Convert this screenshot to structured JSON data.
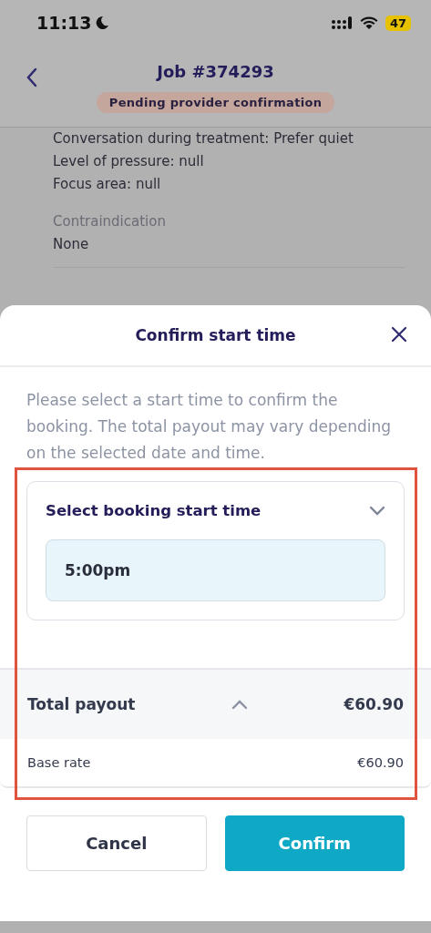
{
  "status_bar": {
    "time": "11:13",
    "battery": "47"
  },
  "header": {
    "title": "Job #374293",
    "status_badge": "Pending provider confirmation"
  },
  "background_details": {
    "lines": [
      "Conversation during treatment: Prefer quiet",
      "Level of pressure: null",
      "Focus area: null"
    ],
    "section_label": "Contraindication",
    "section_value": "None"
  },
  "sheet": {
    "title": "Confirm start time",
    "description": "Please select a start time to confirm the booking. The total payout may vary depending on the selected date and time.",
    "time_picker": {
      "label": "Select booking start time",
      "expanded": true,
      "value": "5:00pm"
    },
    "payout": {
      "label": "Total payout",
      "expanded": true,
      "amount": "€60.90",
      "items": [
        {
          "label": "Base rate",
          "amount": "€60.90"
        }
      ]
    },
    "buttons": [
      {
        "label": "Cancel",
        "kind": "secondary"
      },
      {
        "label": "Confirm",
        "kind": "primary"
      }
    ]
  }
}
